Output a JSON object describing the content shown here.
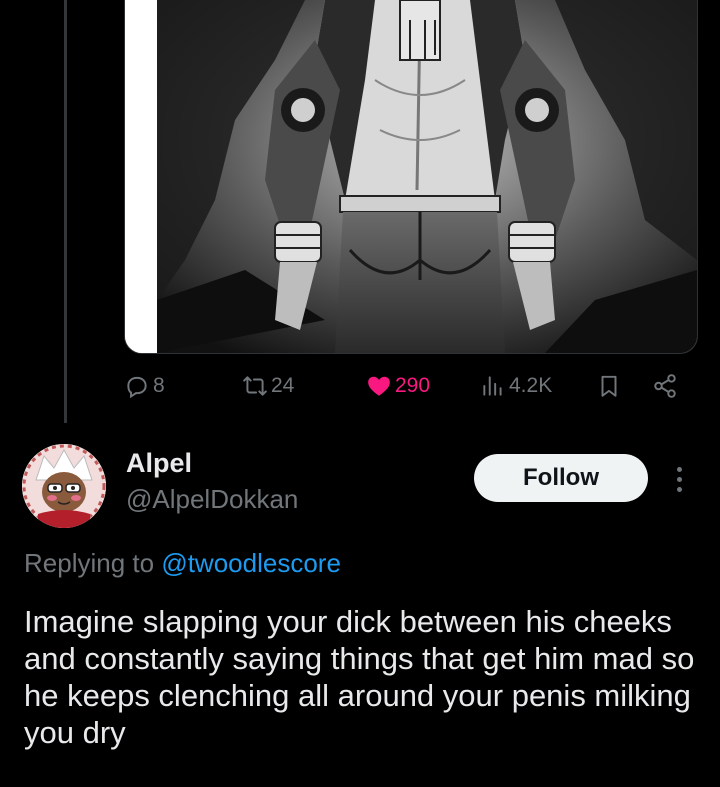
{
  "colors": {
    "background": "#000000",
    "text_primary": "#e7e9ea",
    "text_secondary": "#71767b",
    "like": "#f91880",
    "link": "#1d9bf0",
    "follow_bg": "#eff3f4"
  },
  "actions": {
    "replies": "8",
    "reposts": "24",
    "likes": "290",
    "views": "4.2K",
    "icons": [
      "reply-icon",
      "repost-icon",
      "heart-icon",
      "views-icon",
      "bookmark-icon",
      "share-icon"
    ]
  },
  "reply": {
    "display_name": "Alpel",
    "handle": "@AlpelDokkan",
    "follow_label": "Follow",
    "replying_to_prefix": "Replying to",
    "replying_to_mention": "@twoodlescore",
    "text": "Imagine slapping your dick between his cheeks and constantly saying things that get him mad so he keeps clenching all around your penis milking you dry"
  }
}
